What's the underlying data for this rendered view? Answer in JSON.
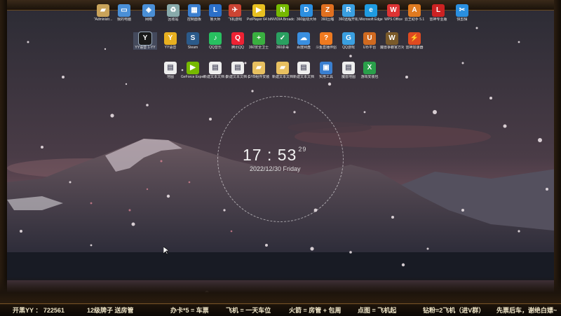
{
  "desktop": {
    "row0": [
      {
        "name": "\"Administr...",
        "icon": "user-folder-icon",
        "color": "#c9a35a"
      },
      {
        "name": "我的电脑",
        "icon": "computer-icon",
        "color": "#4a8fd6"
      },
      {
        "name": "网络",
        "icon": "network-icon",
        "color": "#4a8fd6"
      },
      {
        "name": "回收站",
        "icon": "recycle-bin-icon",
        "color": "#8aa"
      },
      {
        "name": "控制面板",
        "icon": "control-panel-icon",
        "color": "#3b7fd0"
      },
      {
        "name": "鲁大师",
        "icon": "ludashi-icon",
        "color": "#2b6fc8"
      },
      {
        "name": "飞机游戏",
        "icon": "plane-game-icon",
        "color": "#c43"
      },
      {
        "name": "PotPlayer 64 bit",
        "icon": "potplayer-icon",
        "color": "#e8c020"
      },
      {
        "name": "NVIDIA Broadcast",
        "icon": "nvidia-icon",
        "color": "#76b900"
      },
      {
        "name": "360驱动大师",
        "icon": "driver-master-icon",
        "color": "#2b8fe0"
      },
      {
        "name": "360压缩",
        "icon": "zip-icon",
        "color": "#e07020"
      },
      {
        "name": "360远程开机",
        "icon": "remote-icon",
        "color": "#3a9fe0"
      },
      {
        "name": "Microsoft Edge",
        "icon": "edge-icon",
        "color": "#1f9be0"
      },
      {
        "name": "WPS Office",
        "icon": "wps-icon",
        "color": "#d33"
      },
      {
        "name": "云王助手 5.1",
        "icon": "assistant-icon",
        "color": "#e07a20"
      },
      {
        "name": "雷神专业版",
        "icon": "leishen-icon",
        "color": "#c22"
      },
      {
        "name": "快剪辑",
        "icon": "editor-icon",
        "color": "#2a8fe0"
      }
    ],
    "row1": [
      {
        "name": "YY语音 1-YY",
        "icon": "yy-icon",
        "color": "#1a1a1a",
        "selected": true
      },
      {
        "name": "YY语音",
        "icon": "yy-icon",
        "color": "#e8b020"
      },
      {
        "name": "Steam",
        "icon": "steam-icon",
        "color": "#2b5a8a"
      },
      {
        "name": "QQ音乐",
        "icon": "qq-music-icon",
        "color": "#28c060"
      },
      {
        "name": "腾讯QQ",
        "icon": "qq-icon",
        "color": "#e23"
      },
      {
        "name": "360安全卫士",
        "icon": "360-safe-icon",
        "color": "#3ab040"
      },
      {
        "name": "360杀毒",
        "icon": "360-av-icon",
        "color": "#2aa060"
      },
      {
        "name": "百度网盘",
        "icon": "baidu-disk-icon",
        "color": "#3a8fe0"
      },
      {
        "name": "斗鱼直播伴侣",
        "icon": "douyu-icon",
        "color": "#ef7a20"
      },
      {
        "name": "QQ游戏",
        "icon": "qq-game-icon",
        "color": "#3a9fe0"
      },
      {
        "name": "U币平台",
        "icon": "ubi-icon",
        "color": "#d06a20"
      },
      {
        "name": "魔兽争霸官方对战平台",
        "icon": "warcraft-icon",
        "color": "#7a5a2a"
      },
      {
        "name": "雷神加速器",
        "icon": "accelerator-icon",
        "color": "#e04a20"
      }
    ],
    "row2": [
      {
        "name": "地图",
        "icon": "map-file-icon",
        "color": "#eee"
      },
      {
        "name": "GeForce Experience",
        "icon": "geforce-icon",
        "color": "#76b900"
      },
      {
        "name": "新建文本文档 (3).txt",
        "icon": "text-file-icon",
        "color": "#eee"
      },
      {
        "name": "新建文本文档 (2)",
        "icon": "text-file-icon",
        "color": "#eee"
      },
      {
        "name": "GYB组件安装",
        "icon": "folder-icon",
        "color": "#e8c060"
      },
      {
        "name": "新建文本文档",
        "icon": "folder-icon",
        "color": "#e8c060"
      },
      {
        "name": "新建文本文档",
        "icon": "text-file-icon",
        "color": "#eee"
      },
      {
        "name": "实用工具",
        "icon": "tools-icon",
        "color": "#3a7fd0"
      },
      {
        "name": "魔兽地图",
        "icon": "map-file-icon",
        "color": "#eee"
      },
      {
        "name": "游戏安装包",
        "icon": "excel-icon",
        "color": "#2a9f4a"
      }
    ]
  },
  "clock": {
    "hour": "17",
    "sep": " : ",
    "minute": "53",
    "second": "29",
    "date": "2022/12/30 Friday"
  },
  "bottom_bar": [
    "开黑YY ： 722561",
    "12级牌子 送房管",
    "办卡*5 = 车票",
    "飞机 = 一天车位",
    "火箭 = 房管 + 包周",
    "点图 = 飞机起",
    "钻粉=2飞机（进V群）",
    "先票后车，谢绝白嫖~"
  ]
}
